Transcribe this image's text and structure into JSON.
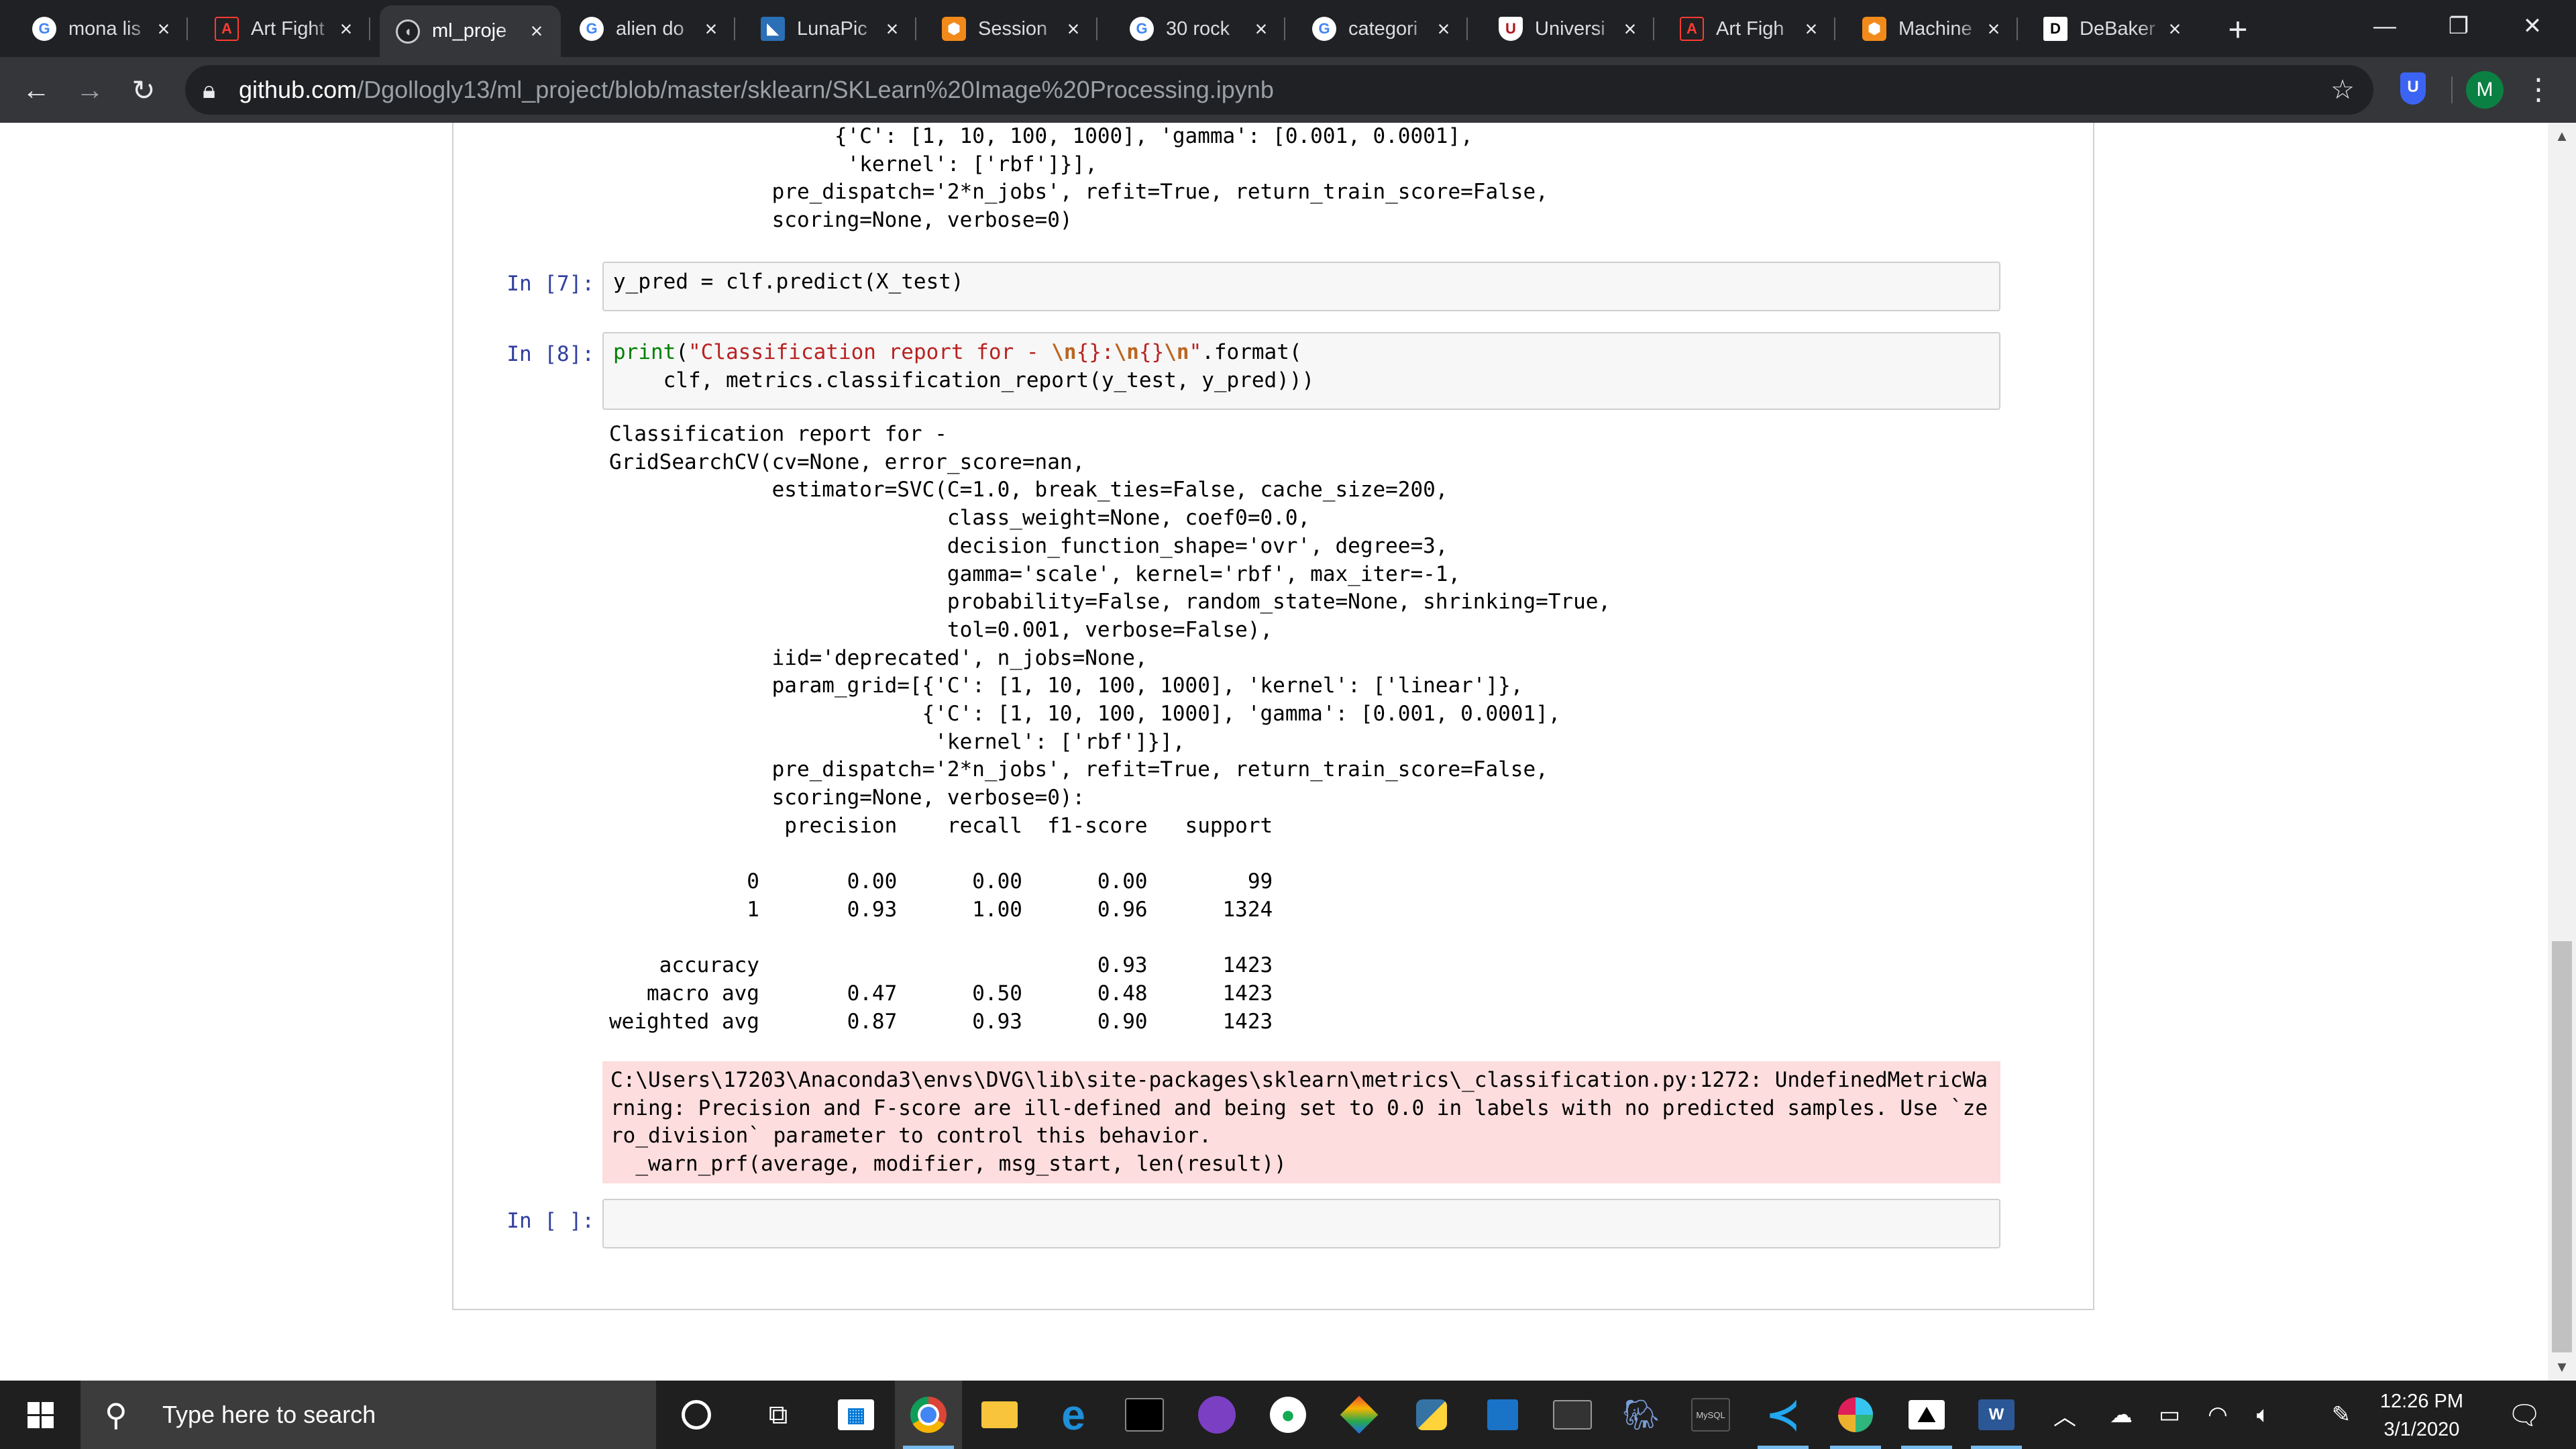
{
  "browser": {
    "tabs": [
      {
        "title": "mona lis",
        "favicon": "google-icon",
        "active": false
      },
      {
        "title": "Art Fight",
        "favicon": "artfight-icon",
        "active": false
      },
      {
        "title": "ml_proje",
        "favicon": "github-icon",
        "active": true
      },
      {
        "title": "alien do",
        "favicon": "google-icon",
        "active": false
      },
      {
        "title": "LunaPic",
        "favicon": "lunapic-icon",
        "active": false
      },
      {
        "title": "Session",
        "favicon": "hexagon-icon",
        "active": false
      },
      {
        "title": "30 rock",
        "favicon": "google-icon",
        "active": false
      },
      {
        "title": "categori",
        "favicon": "google-icon",
        "active": false
      },
      {
        "title": "Universi",
        "favicon": "university-shield-icon",
        "active": false
      },
      {
        "title": "Art Figh",
        "favicon": "artfight-icon",
        "active": false
      },
      {
        "title": "Machine",
        "favicon": "hexagon-icon",
        "active": false
      },
      {
        "title": "DeBaker",
        "favicon": "d-icon",
        "active": false
      }
    ],
    "url_host": "github.com",
    "url_path": "/Dgollogly13/ml_project/blob/master/sklearn/SKLearn%20Image%20Processing.ipynb",
    "profile_initial": "M",
    "extension_label": "U",
    "colors": {
      "tabstrip": "#202124",
      "toolbar": "#35363a",
      "avatar": "#0b8043"
    }
  },
  "notebook": {
    "top_output_lines": [
      "                  {'C': [1, 10, 100, 1000], 'gamma': [0.001, 0.0001],",
      "                   'kernel': ['rbf']}],",
      "             pre_dispatch='2*n_jobs', refit=True, return_train_score=False,",
      "             scoring=None, verbose=0)"
    ],
    "cell7": {
      "prompt": "In [7]:",
      "code": "y_pred = clf.predict(X_test)"
    },
    "cell8": {
      "prompt": "In [8]:",
      "code_print": "print",
      "code_open": "(",
      "code_str_a": "\"Classification report for - ",
      "code_esc_a": "\\n",
      "code_str_b": "{}:",
      "code_esc_b": "\\n",
      "code_str_c": "{}",
      "code_esc_c": "\\n",
      "code_str_d": "\"",
      "code_rest1": ".format(",
      "code_line2": "    clf, metrics.classification_report(y_test, y_pred)))",
      "output_lines": [
        "Classification report for -",
        "GridSearchCV(cv=None, error_score=nan,",
        "             estimator=SVC(C=1.0, break_ties=False, cache_size=200,",
        "                           class_weight=None, coef0=0.0,",
        "                           decision_function_shape='ovr', degree=3,",
        "                           gamma='scale', kernel='rbf', max_iter=-1,",
        "                           probability=False, random_state=None, shrinking=True,",
        "                           tol=0.001, verbose=False),",
        "             iid='deprecated', n_jobs=None,",
        "             param_grid=[{'C': [1, 10, 100, 1000], 'kernel': ['linear']},",
        "                         {'C': [1, 10, 100, 1000], 'gamma': [0.001, 0.0001],",
        "                          'kernel': ['rbf']}],",
        "             pre_dispatch='2*n_jobs', refit=True, return_train_score=False,",
        "             scoring=None, verbose=0):",
        "              precision    recall  f1-score   support",
        "",
        "           0       0.00      0.00      0.00        99",
        "           1       0.93      1.00      0.96      1324",
        "",
        "    accuracy                           0.93      1423",
        "   macro avg       0.47      0.50      0.48      1423",
        "weighted avg       0.87      0.93      0.90      1423"
      ],
      "stderr": "C:\\Users\\17203\\Anaconda3\\envs\\DVG\\lib\\site-packages\\sklearn\\metrics\\_classification.py:1272: UndefinedMetricWarning: Precision and F-score are ill-defined and being set to 0.0 in labels with no predicted samples. Use `zero_division` parameter to control this behavior.\n  _warn_prf(average, modifier, msg_start, len(result))"
    },
    "empty_cell": {
      "prompt": "In [ ]:",
      "value": ""
    },
    "colors": {
      "prompt": "#303f9f",
      "stderr_bg": "#fddddd",
      "input_bg": "#f7f7f7"
    }
  },
  "taskbar": {
    "search_placeholder": "Type here to search",
    "time": "12:26 PM",
    "date": "3/1/2020",
    "pinned": [
      "cortana-icon",
      "task-view-icon",
      "store-icon",
      "chrome-icon",
      "file-explorer-icon",
      "edge-icon",
      "terminal-icon",
      "github-desktop-icon",
      "mongodb-icon",
      "sourcetree-icon",
      "python-icon",
      "virtualbox-icon",
      "cmd-icon",
      "pgadmin-icon",
      "mysql-icon",
      "vscode-icon",
      "slack-icon",
      "photos-icon",
      "word-icon"
    ],
    "mysql_label": "MySQL",
    "word_label": "W"
  }
}
